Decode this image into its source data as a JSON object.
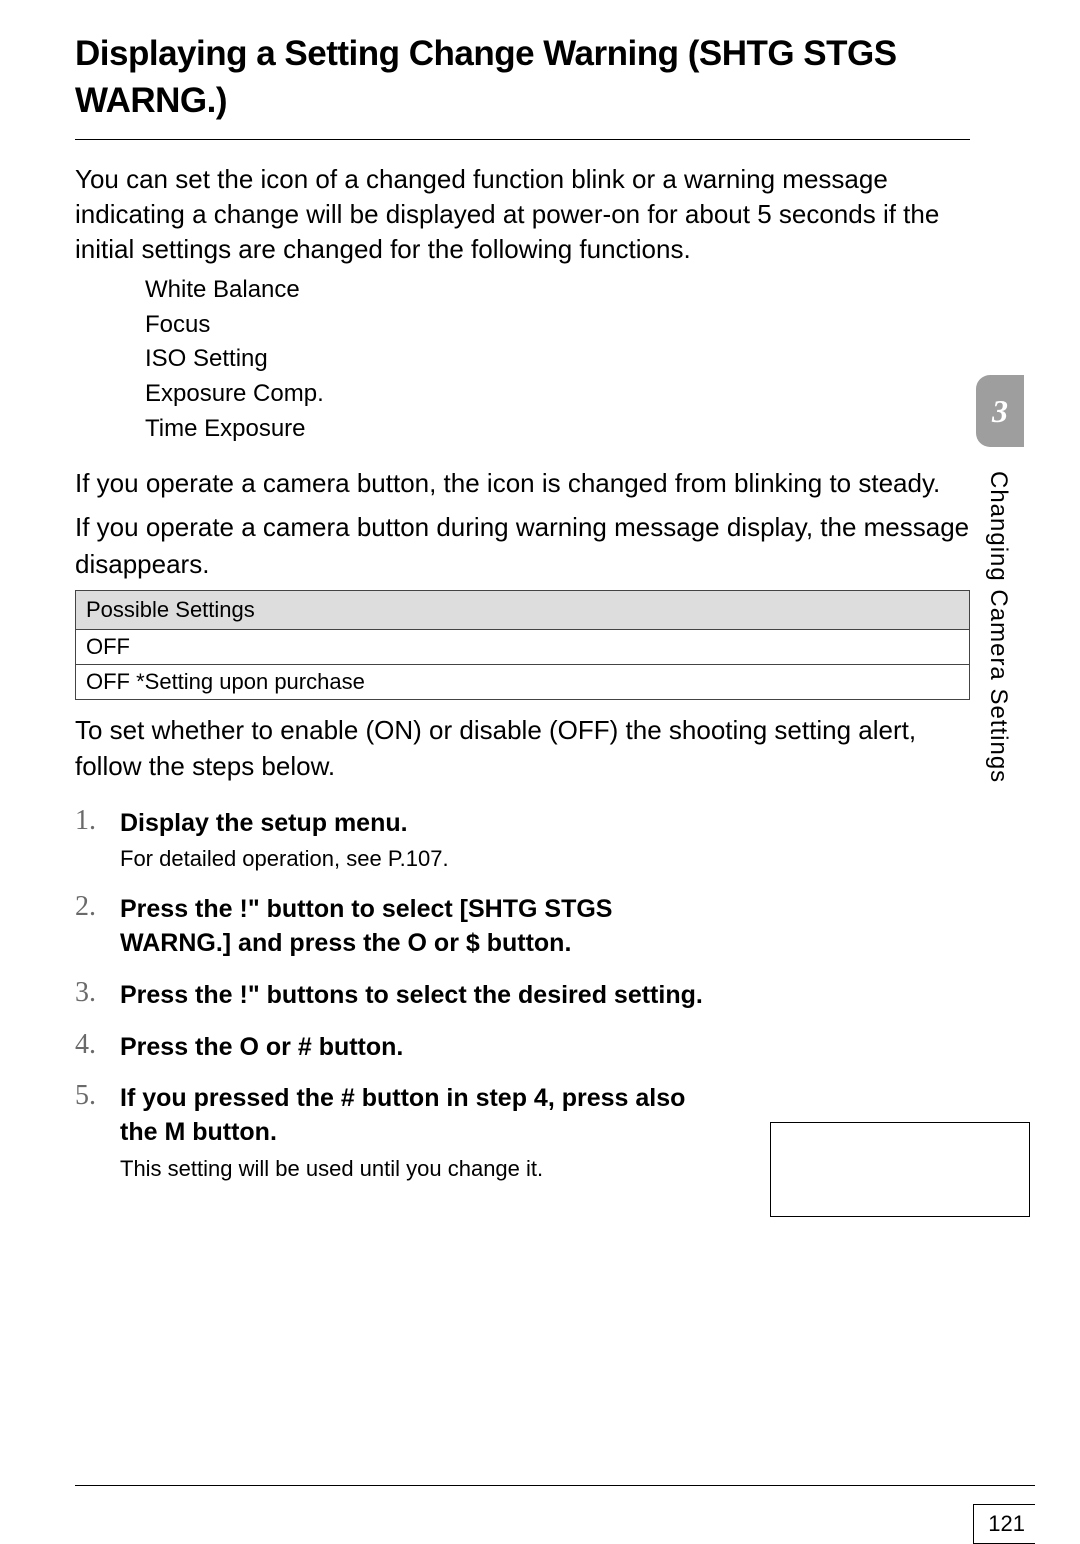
{
  "heading": "Displaying a Setting Change Warning (SHTG STGS WARNG.)",
  "intro": "You can set the icon of a changed function blink or a warning message indicating a change will be displayed at power-on for about 5 seconds if the initial settings are changed for the following functions.",
  "functions": [
    "White Balance",
    "Focus",
    "ISO Setting",
    "Exposure Comp.",
    "Time Exposure"
  ],
  "operate1": "If you operate a camera button, the icon is changed from blinking to steady.",
  "operate2": "If you operate a camera button during warning message display, the message disappears.",
  "tableHeader": "Possible Settings",
  "tableRow1": "OFF",
  "tableRow2": "OFF   *Setting upon purchase",
  "belowTable": "To set whether to enable (ON) or disable (OFF) the shooting setting alert, follow the steps below.",
  "steps": [
    {
      "title": "Display the setup menu.",
      "body": "For detailed operation, see P.107."
    },
    {
      "title": "Press the !\" button to select [SHTG STGS WARNG.] and press the O or $ button."
    },
    {
      "title": "Press the !\" buttons to select the desired setting."
    },
    {
      "title": "Press the O or # button."
    },
    {
      "title": "If you pressed the # button in step 4, press also the M button.",
      "body": "This setting will be used until you change it."
    }
  ],
  "sideChapter": "3",
  "sideLabel": "Changing Camera Settings",
  "pageNumber": "121"
}
